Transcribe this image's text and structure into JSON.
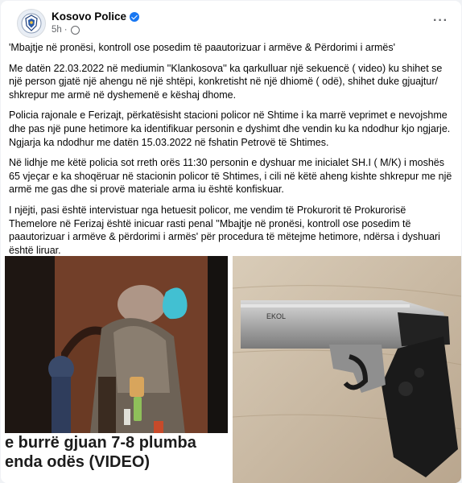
{
  "post": {
    "author": "Kosovo Police",
    "time": "5h",
    "more_label": "···",
    "paragraphs": [
      "'Mbajtje në pronësi, kontroll ose posedim të paautorizuar i armëve & Përdorimi i armës'",
      "Me datën 22.03.2022 në mediumin ''Klankosova'' ka qarkulluar një sekuencë ( video) ku shihet se një person gjatë një ahengu në një shtëpi, konkretisht në një dhiomë ( odë), shihet duke gjuajtur/ shkrepur me armë në dyshemenë e këshaj dhome.",
      "Policia rajonale e Ferizajt, përkatësisht stacioni policor në Shtime i ka marrë veprimet e nevojshme dhe pas një pune hetimore ka identifikuar personin e dyshimt dhe vendin ku ka ndodhur kjo ngjarje. Ngjarja ka ndodhur me datën 15.03.2022 në fshatin Petrovë të Shtimes.",
      "Në lidhje me këtë policia  sot rreth orës 11:30 personin e dyshuar me inicialet SH.I  ( M/K) i moshës 65 vjeçar e ka shoqëruar në stacionin policor të Shtimes, i cili në këtë aheng kishte shkrepur me një armë me gas dhe si provë materiale arma iu është konfiskuar.",
      "I njëjti, pasi është intervistuar nga hetuesit policor, me vendim të Prokurorit të Prokurorisë Themelore në Ferizaj është inicuar rasti penal ''Mbajtje në pronësi, kontroll ose posedim të paautorizuar i armëve & përdorimi i armës' për procedura të mëtejme hetimore, ndërsa i dyshuari është liruar."
    ]
  },
  "photo_left": {
    "caption_line1": "e burrë gjuan 7-8 plumba",
    "caption_line2": "enda odës (VIDEO)"
  },
  "photo_right": {
    "engraving": "EKOL"
  },
  "icons": {
    "avatar": "police-badge-icon",
    "verified": "verified-badge-icon",
    "privacy": "globe-icon",
    "more": "more-options-icon"
  }
}
